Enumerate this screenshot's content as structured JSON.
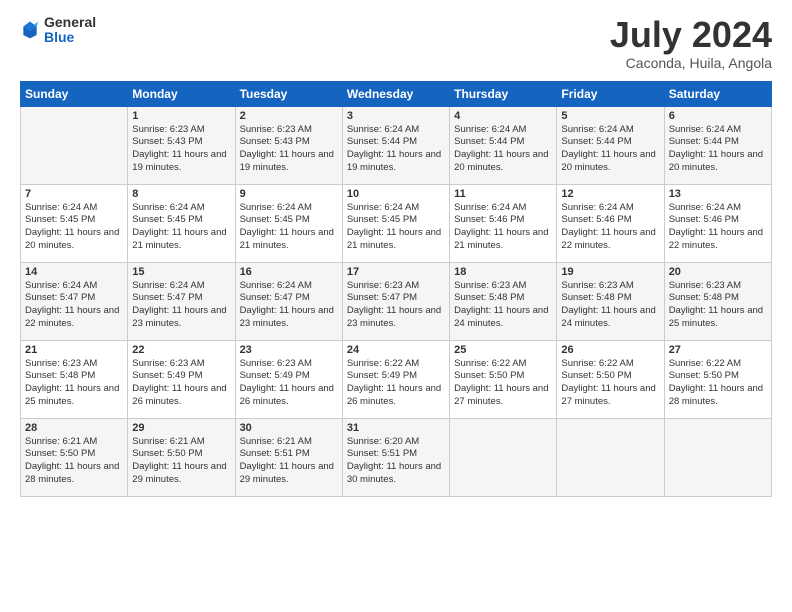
{
  "logo": {
    "general": "General",
    "blue": "Blue"
  },
  "title": "July 2024",
  "subtitle": "Caconda, Huila, Angola",
  "days": [
    "Sunday",
    "Monday",
    "Tuesday",
    "Wednesday",
    "Thursday",
    "Friday",
    "Saturday"
  ],
  "weeks": [
    [
      {
        "num": "",
        "sunrise": "",
        "sunset": "",
        "daylight": ""
      },
      {
        "num": "1",
        "sunrise": "Sunrise: 6:23 AM",
        "sunset": "Sunset: 5:43 PM",
        "daylight": "Daylight: 11 hours and 19 minutes."
      },
      {
        "num": "2",
        "sunrise": "Sunrise: 6:23 AM",
        "sunset": "Sunset: 5:43 PM",
        "daylight": "Daylight: 11 hours and 19 minutes."
      },
      {
        "num": "3",
        "sunrise": "Sunrise: 6:24 AM",
        "sunset": "Sunset: 5:44 PM",
        "daylight": "Daylight: 11 hours and 19 minutes."
      },
      {
        "num": "4",
        "sunrise": "Sunrise: 6:24 AM",
        "sunset": "Sunset: 5:44 PM",
        "daylight": "Daylight: 11 hours and 20 minutes."
      },
      {
        "num": "5",
        "sunrise": "Sunrise: 6:24 AM",
        "sunset": "Sunset: 5:44 PM",
        "daylight": "Daylight: 11 hours and 20 minutes."
      },
      {
        "num": "6",
        "sunrise": "Sunrise: 6:24 AM",
        "sunset": "Sunset: 5:44 PM",
        "daylight": "Daylight: 11 hours and 20 minutes."
      }
    ],
    [
      {
        "num": "7",
        "sunrise": "Sunrise: 6:24 AM",
        "sunset": "Sunset: 5:45 PM",
        "daylight": "Daylight: 11 hours and 20 minutes."
      },
      {
        "num": "8",
        "sunrise": "Sunrise: 6:24 AM",
        "sunset": "Sunset: 5:45 PM",
        "daylight": "Daylight: 11 hours and 21 minutes."
      },
      {
        "num": "9",
        "sunrise": "Sunrise: 6:24 AM",
        "sunset": "Sunset: 5:45 PM",
        "daylight": "Daylight: 11 hours and 21 minutes."
      },
      {
        "num": "10",
        "sunrise": "Sunrise: 6:24 AM",
        "sunset": "Sunset: 5:45 PM",
        "daylight": "Daylight: 11 hours and 21 minutes."
      },
      {
        "num": "11",
        "sunrise": "Sunrise: 6:24 AM",
        "sunset": "Sunset: 5:46 PM",
        "daylight": "Daylight: 11 hours and 21 minutes."
      },
      {
        "num": "12",
        "sunrise": "Sunrise: 6:24 AM",
        "sunset": "Sunset: 5:46 PM",
        "daylight": "Daylight: 11 hours and 22 minutes."
      },
      {
        "num": "13",
        "sunrise": "Sunrise: 6:24 AM",
        "sunset": "Sunset: 5:46 PM",
        "daylight": "Daylight: 11 hours and 22 minutes."
      }
    ],
    [
      {
        "num": "14",
        "sunrise": "Sunrise: 6:24 AM",
        "sunset": "Sunset: 5:47 PM",
        "daylight": "Daylight: 11 hours and 22 minutes."
      },
      {
        "num": "15",
        "sunrise": "Sunrise: 6:24 AM",
        "sunset": "Sunset: 5:47 PM",
        "daylight": "Daylight: 11 hours and 23 minutes."
      },
      {
        "num": "16",
        "sunrise": "Sunrise: 6:24 AM",
        "sunset": "Sunset: 5:47 PM",
        "daylight": "Daylight: 11 hours and 23 minutes."
      },
      {
        "num": "17",
        "sunrise": "Sunrise: 6:23 AM",
        "sunset": "Sunset: 5:47 PM",
        "daylight": "Daylight: 11 hours and 23 minutes."
      },
      {
        "num": "18",
        "sunrise": "Sunrise: 6:23 AM",
        "sunset": "Sunset: 5:48 PM",
        "daylight": "Daylight: 11 hours and 24 minutes."
      },
      {
        "num": "19",
        "sunrise": "Sunrise: 6:23 AM",
        "sunset": "Sunset: 5:48 PM",
        "daylight": "Daylight: 11 hours and 24 minutes."
      },
      {
        "num": "20",
        "sunrise": "Sunrise: 6:23 AM",
        "sunset": "Sunset: 5:48 PM",
        "daylight": "Daylight: 11 hours and 25 minutes."
      }
    ],
    [
      {
        "num": "21",
        "sunrise": "Sunrise: 6:23 AM",
        "sunset": "Sunset: 5:48 PM",
        "daylight": "Daylight: 11 hours and 25 minutes."
      },
      {
        "num": "22",
        "sunrise": "Sunrise: 6:23 AM",
        "sunset": "Sunset: 5:49 PM",
        "daylight": "Daylight: 11 hours and 26 minutes."
      },
      {
        "num": "23",
        "sunrise": "Sunrise: 6:23 AM",
        "sunset": "Sunset: 5:49 PM",
        "daylight": "Daylight: 11 hours and 26 minutes."
      },
      {
        "num": "24",
        "sunrise": "Sunrise: 6:22 AM",
        "sunset": "Sunset: 5:49 PM",
        "daylight": "Daylight: 11 hours and 26 minutes."
      },
      {
        "num": "25",
        "sunrise": "Sunrise: 6:22 AM",
        "sunset": "Sunset: 5:50 PM",
        "daylight": "Daylight: 11 hours and 27 minutes."
      },
      {
        "num": "26",
        "sunrise": "Sunrise: 6:22 AM",
        "sunset": "Sunset: 5:50 PM",
        "daylight": "Daylight: 11 hours and 27 minutes."
      },
      {
        "num": "27",
        "sunrise": "Sunrise: 6:22 AM",
        "sunset": "Sunset: 5:50 PM",
        "daylight": "Daylight: 11 hours and 28 minutes."
      }
    ],
    [
      {
        "num": "28",
        "sunrise": "Sunrise: 6:21 AM",
        "sunset": "Sunset: 5:50 PM",
        "daylight": "Daylight: 11 hours and 28 minutes."
      },
      {
        "num": "29",
        "sunrise": "Sunrise: 6:21 AM",
        "sunset": "Sunset: 5:50 PM",
        "daylight": "Daylight: 11 hours and 29 minutes."
      },
      {
        "num": "30",
        "sunrise": "Sunrise: 6:21 AM",
        "sunset": "Sunset: 5:51 PM",
        "daylight": "Daylight: 11 hours and 29 minutes."
      },
      {
        "num": "31",
        "sunrise": "Sunrise: 6:20 AM",
        "sunset": "Sunset: 5:51 PM",
        "daylight": "Daylight: 11 hours and 30 minutes."
      },
      {
        "num": "",
        "sunrise": "",
        "sunset": "",
        "daylight": ""
      },
      {
        "num": "",
        "sunrise": "",
        "sunset": "",
        "daylight": ""
      },
      {
        "num": "",
        "sunrise": "",
        "sunset": "",
        "daylight": ""
      }
    ]
  ]
}
